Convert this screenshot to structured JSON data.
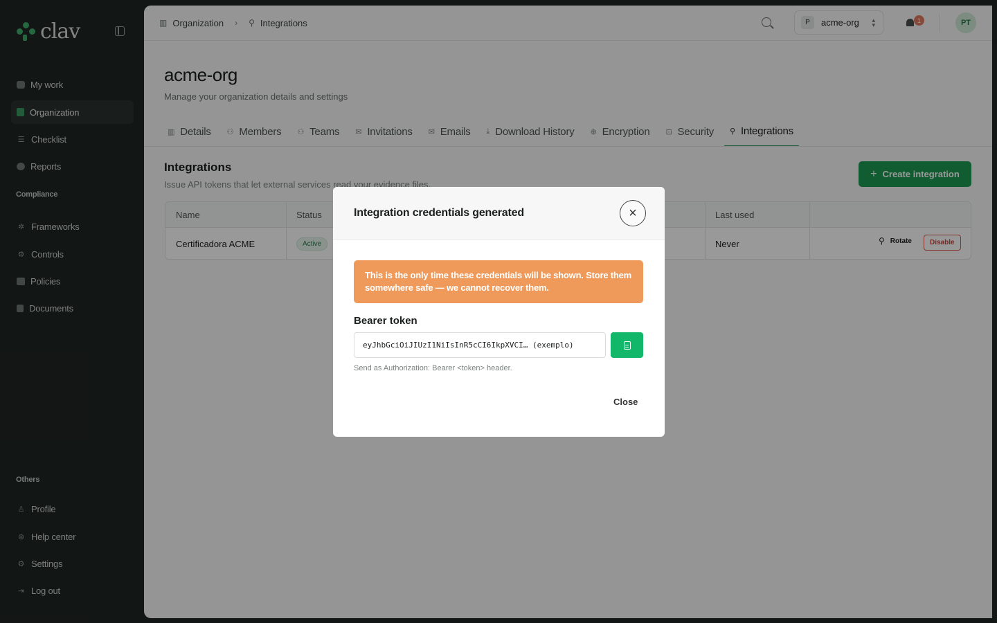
{
  "brand": {
    "name": "clav"
  },
  "sidebar": {
    "items": [
      {
        "label": "My work",
        "icon": "inbox-icon"
      },
      {
        "label": "Organization",
        "icon": "building-icon"
      },
      {
        "label": "Checklist",
        "icon": "list-icon"
      },
      {
        "label": "Reports",
        "icon": "chart-icon"
      }
    ],
    "compliance_label": "Compliance",
    "compliance_items": [
      {
        "label": "Frameworks",
        "icon": "layers-icon"
      },
      {
        "label": "Controls",
        "icon": "shield-icon"
      },
      {
        "label": "Policies",
        "icon": "file-icon"
      },
      {
        "label": "Documents",
        "icon": "document-icon"
      }
    ],
    "others_label": "Others",
    "others_items": [
      {
        "label": "Profile",
        "icon": "user-icon"
      },
      {
        "label": "Help center",
        "icon": "help-icon"
      },
      {
        "label": "Settings",
        "icon": "gear-icon"
      },
      {
        "label": "Log out",
        "icon": "logout-icon"
      }
    ]
  },
  "topbar": {
    "breadcrumb": [
      "Organization",
      "Integrations"
    ],
    "org_switch": {
      "initial": "P",
      "name": "acme-org"
    },
    "notifications": "1",
    "user_initials": "PT"
  },
  "page": {
    "title": "acme-org",
    "subtitle": "Manage your organization details and settings",
    "tabs": [
      "Details",
      "Members",
      "Teams",
      "Invitations",
      "Emails",
      "Download History",
      "Encryption",
      "Security",
      "Integrations"
    ],
    "active_tab": "Integrations"
  },
  "integrations": {
    "title": "Integrations",
    "description": "Issue API tokens that let external services read your evidence files.",
    "create_label": "Create integration",
    "columns": [
      "Name",
      "Status",
      "Last used"
    ],
    "rows": [
      {
        "name": "Certificadora ACME",
        "status": "Active",
        "last_used": "Never",
        "rotate": "Rotate",
        "disable": "Disable"
      }
    ]
  },
  "modal": {
    "title": "Integration credentials generated",
    "warning": "This is the only time these credentials will be shown. Store them somewhere safe — we cannot recover them.",
    "token_label": "Bearer token",
    "token_value": "eyJhbGciOiJIUzI1NiIsInR5cCI6IkpXVCI… (exemplo)",
    "token_help": "Send as Authorization: Bearer <token> header.",
    "close_label": "Close"
  },
  "colors": {
    "primary": "#1f9a54",
    "warning": "#ef9a5a",
    "danger": "#c9473b",
    "sidebar_bg": "#1f2523"
  }
}
